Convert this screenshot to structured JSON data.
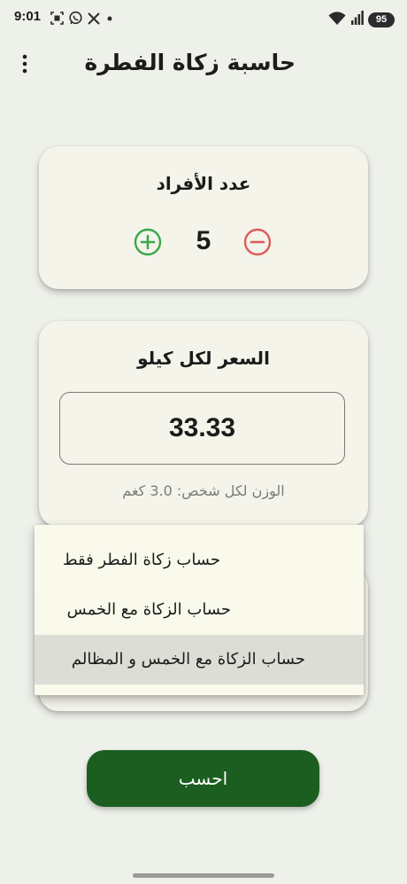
{
  "status_bar": {
    "time": "9:01",
    "battery": "95",
    "icons": [
      "screenshot-icon",
      "whatsapp-icon",
      "x-icon",
      "dot-icon",
      "wifi-icon",
      "signal-icon"
    ]
  },
  "app_bar": {
    "title": "حاسبة زكاة الفطرة",
    "menu_icon": "more-vert-icon"
  },
  "people_card": {
    "title": "عدد الأفراد",
    "count": "5",
    "plus_icon": "add-circle-icon",
    "minus_icon": "remove-circle-icon"
  },
  "price_card": {
    "title": "السعر لكل كيلو",
    "price_value": "33.33",
    "weight_note": "الوزن لكل شخص: 3.0 كغم"
  },
  "calculation_menu": {
    "selected_index": 2,
    "options": [
      {
        "label": "حساب زكاة الفطر فقط"
      },
      {
        "label": "حساب الزكاة مع الخمس"
      },
      {
        "label": "حساب الزكاة مع الخمس و المظالم"
      }
    ]
  },
  "actions": {
    "calculate_label": "احسب"
  },
  "colors": {
    "background": "#eef0ea",
    "card": "#f4f4ea",
    "primary_button": "#1c5e20",
    "plus_green": "#3aa84a",
    "minus_red": "#e05a5a",
    "menu_selected": "#dcddd5"
  }
}
